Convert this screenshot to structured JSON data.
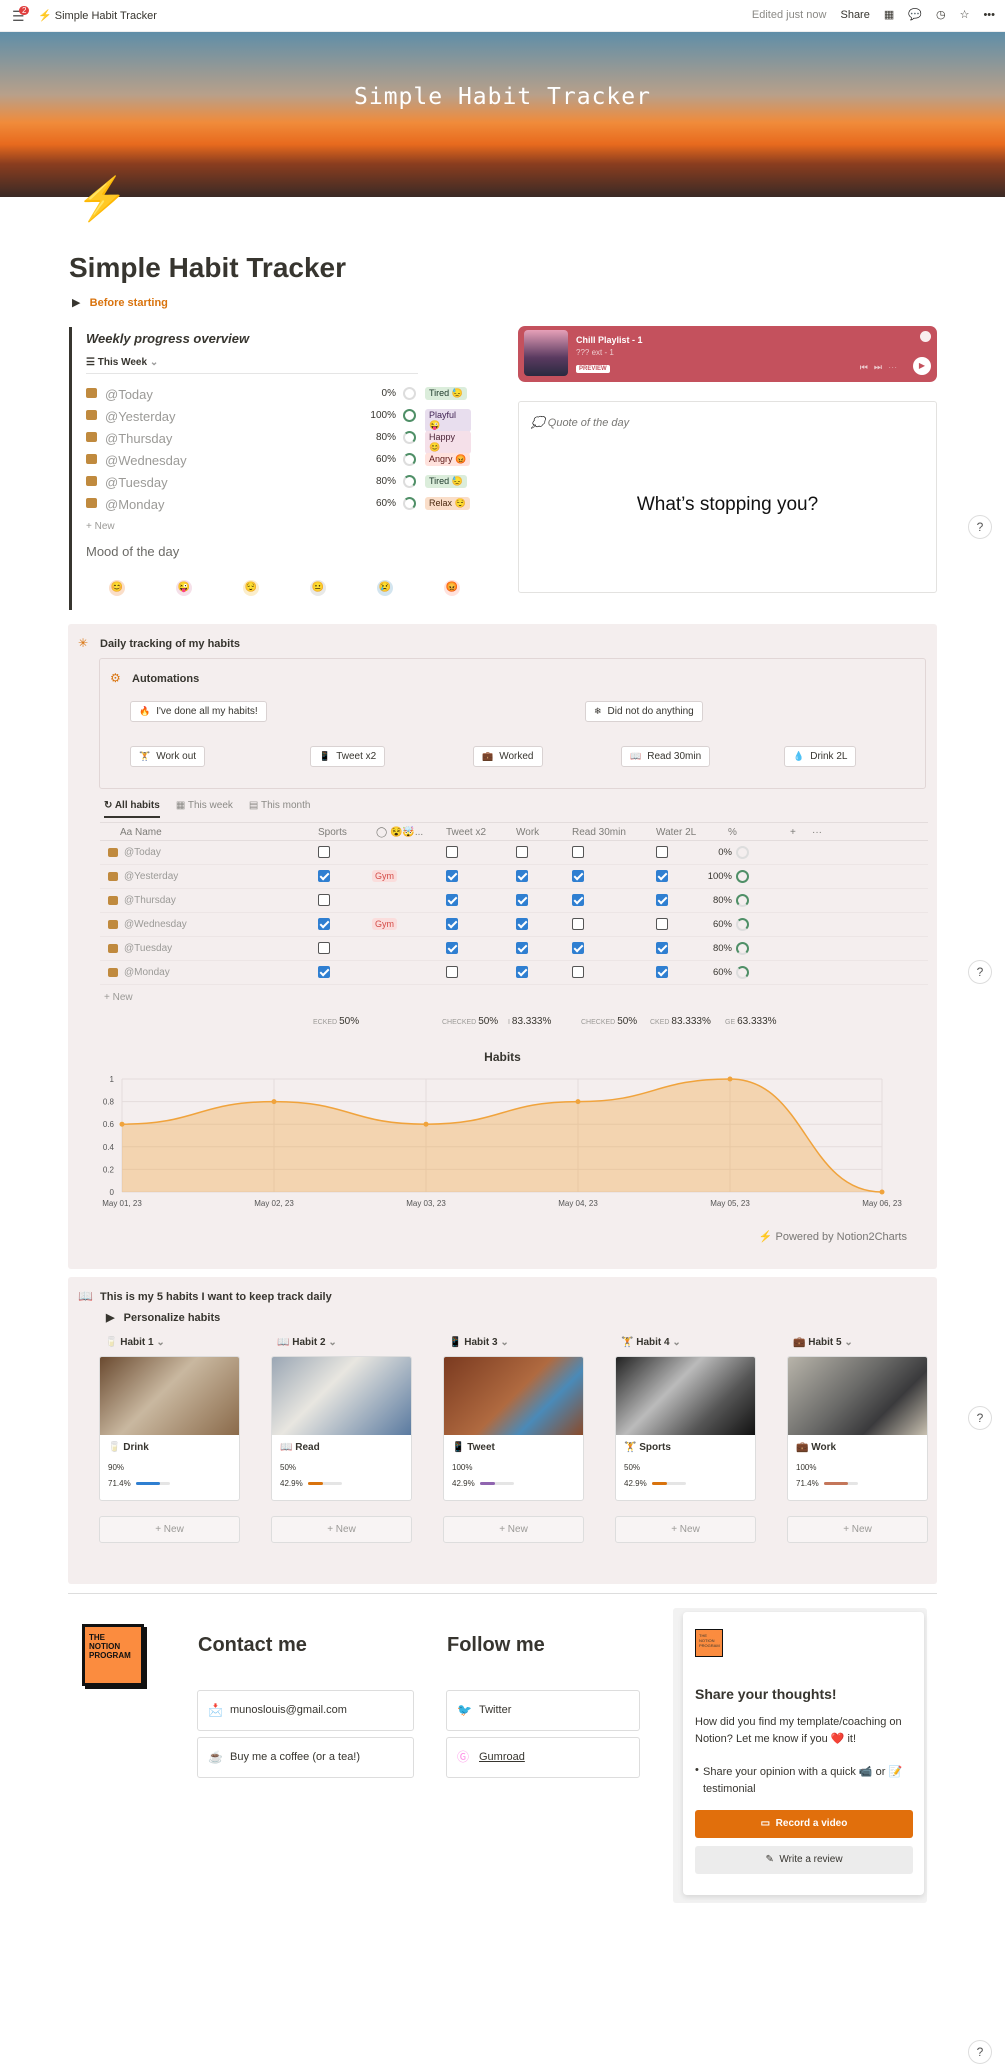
{
  "topbar": {
    "badge": "2",
    "breadcrumb": "Simple Habit Tracker",
    "edited": "Edited just now",
    "share": "Share"
  },
  "cover": {
    "title": "Simple Habit Tracker"
  },
  "page": {
    "title": "Simple Habit Tracker",
    "before_starting": "Before starting"
  },
  "weekly": {
    "title": "Weekly progress overview",
    "view": "This Week",
    "rows": [
      {
        "name": "@Today",
        "pct": "0%",
        "mood": "Tired 😓"
      },
      {
        "name": "@Yesterday",
        "pct": "100%",
        "mood": "Playful 😜"
      },
      {
        "name": "@Thursday",
        "pct": "80%",
        "mood": "Happy 😊"
      },
      {
        "name": "@Wednesday",
        "pct": "60%",
        "mood": "Angry 😡"
      },
      {
        "name": "@Tuesday",
        "pct": "80%",
        "mood": "Tired 😓"
      },
      {
        "name": "@Monday",
        "pct": "60%",
        "mood": "Relax 😌"
      }
    ],
    "new": "+ New",
    "mood_title": "Mood of the day"
  },
  "player": {
    "title": "Chill Playlist - 1",
    "sub": "??? ext - 1",
    "preview": "PREVIEW"
  },
  "quote": {
    "header": "Quote of the day",
    "text": "What’s stopping you?"
  },
  "daily": {
    "title": "Daily tracking of my habits",
    "automations": "Automations",
    "buttons": [
      "I've done all my habits!",
      "Did not do anything",
      "Work out",
      "Tweet x2",
      "Worked",
      "Read 30min",
      "Drink 2L"
    ],
    "tabs": [
      "All habits",
      "This week",
      "This month"
    ],
    "columns": [
      "Aa Name",
      "Sports",
      "◯ 😵🤯...",
      "Tweet x2",
      "Work",
      "Read 30min",
      "Water 2L",
      "%"
    ],
    "rows": [
      {
        "name": "@Today",
        "pct": "0%"
      },
      {
        "name": "@Yesterday",
        "pct": "100%",
        "gym": "Gym"
      },
      {
        "name": "@Thursday",
        "pct": "80%"
      },
      {
        "name": "@Wednesday",
        "pct": "60%",
        "gym": "Gym"
      },
      {
        "name": "@Tuesday",
        "pct": "80%"
      },
      {
        "name": "@Monday",
        "pct": "60%"
      }
    ],
    "new": "+ New",
    "calcs": [
      {
        "label": "ECKED",
        "value": "50%"
      },
      {
        "label": "CHECKED",
        "value": "50%"
      },
      {
        "label": "I",
        "value": "83.333%"
      },
      {
        "label": "CHECKED",
        "value": "50%"
      },
      {
        "label": "CKED",
        "value": "83.333%"
      },
      {
        "label": "GE",
        "value": "63.333%"
      }
    ],
    "powered": "Powered by Notion2Charts"
  },
  "chart_data": {
    "type": "area",
    "title": "Habits",
    "x": [
      "May 01, 23",
      "May 02, 23",
      "May 03, 23",
      "May 04, 23",
      "May 05, 23",
      "May 06, 23"
    ],
    "values": [
      0.6,
      0.8,
      0.6,
      0.8,
      1.0,
      0
    ],
    "yticks": [
      "0",
      "0.2",
      "0.4",
      "0.6",
      "0.8",
      "1"
    ],
    "ylim": [
      0,
      1
    ],
    "grid": true,
    "color": "#f0a33c"
  },
  "habits": {
    "title": "This is my 5 habits I want to keep track daily",
    "personalize": "Personalize habits",
    "cols": [
      {
        "head": "Habit 1",
        "name": "Drink",
        "pct": "90%",
        "ratio": "71.4%",
        "fill": 0.714,
        "color": "#2f7fd1"
      },
      {
        "head": "Habit 2",
        "name": "Read",
        "pct": "50%",
        "ratio": "42.9%",
        "fill": 0.429,
        "color": "#d9730d"
      },
      {
        "head": "Habit 3",
        "name": "Tweet",
        "pct": "100%",
        "ratio": "42.9%",
        "fill": 0.429,
        "color": "#9065b0"
      },
      {
        "head": "Habit 4",
        "name": "Sports",
        "pct": "50%",
        "ratio": "42.9%",
        "fill": 0.429,
        "color": "#d9730d"
      },
      {
        "head": "Habit 5",
        "name": "Work",
        "pct": "100%",
        "ratio": "71.4%",
        "fill": 0.714,
        "color": "#c4765a"
      }
    ],
    "new": "+ New"
  },
  "footer": {
    "logo": "THE NOTION PROGRAM",
    "contact": "Contact me",
    "email": "munoslouis@gmail.com",
    "coffee": "Buy me a coffee (or a tea!)",
    "follow": "Follow me",
    "twitter": "Twitter",
    "gumroad": "Gumroad",
    "share_title": "Share your thoughts!",
    "share_desc": "How did you find my template/coaching on Notion? Let me know if you ❤️ it!",
    "share_bullet": "Share your opinion with a quick 📹 or 📝 testimonial",
    "record": "Record a video",
    "write": "Write a review"
  }
}
